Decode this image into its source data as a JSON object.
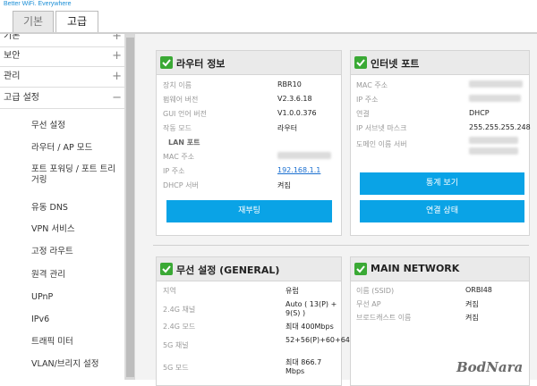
{
  "brand": "Better WiFi. Everywhere",
  "tabs": [
    {
      "label": "기본"
    },
    {
      "label": "고급"
    }
  ],
  "sidebar": {
    "categories": [
      {
        "label": "기본",
        "plus": "+"
      },
      {
        "label": "보안",
        "plus": "+"
      },
      {
        "label": "관리",
        "plus": "+"
      },
      {
        "label": "고급 설정",
        "plus": "−"
      }
    ],
    "items": [
      {
        "label": "무선 설정"
      },
      {
        "label": "라우터 / AP 모드"
      },
      {
        "label": "포트 포워딩 / 포트 트리거링"
      },
      {
        "label": "유동 DNS"
      },
      {
        "label": "VPN 서비스"
      },
      {
        "label": "고정 라우트"
      },
      {
        "label": "원격 관리"
      },
      {
        "label": "UPnP"
      },
      {
        "label": "IPv6"
      },
      {
        "label": "트래픽 미터"
      },
      {
        "label": "VLAN/브리지 설정"
      }
    ]
  },
  "router_info": {
    "title": "라우터 정보",
    "rows": [
      {
        "label": "장치 이름",
        "value": "RBR10"
      },
      {
        "label": "펌웨어 버전",
        "value": "V2.3.6.18"
      },
      {
        "label": "GUI 언어 버전",
        "value": "V1.0.0.376"
      },
      {
        "label": "작동 모드",
        "value": "라우터"
      }
    ],
    "lan_header": "LAN 포트",
    "lan_rows": [
      {
        "label": "MAC 주소",
        "value": ""
      },
      {
        "label": "IP 주소",
        "value": "192.168.1.1"
      },
      {
        "label": "DHCP 서버",
        "value": "켜짐"
      }
    ],
    "button": "재부팅"
  },
  "internet_port": {
    "title": "인터넷 포트",
    "rows": [
      {
        "label": "MAC 주소",
        "value": ""
      },
      {
        "label": "IP 주소",
        "value": ""
      },
      {
        "label": "연결",
        "value": "DHCP"
      },
      {
        "label": "IP 서브넷 마스크",
        "value": "255.255.255.248"
      },
      {
        "label": "도메인 이름 서버",
        "value": ""
      }
    ],
    "button_stats": "통계 보기",
    "button_status": "연결 상태"
  },
  "wireless": {
    "title": "무선 설정 (GENERAL)",
    "rows": [
      {
        "label": "지역",
        "value": "유럽"
      },
      {
        "label": "2.4G 채널",
        "value": "Auto ( 13(P) + 9(S) )"
      },
      {
        "label": "2.4G 모드",
        "value": "최대 400Mbps"
      },
      {
        "label": "5G 채널",
        "value": "52+56(P)+60+64"
      },
      {
        "label": "5G 모드",
        "value": "최대 866.7 Mbps"
      }
    ]
  },
  "main_network": {
    "title": "MAIN NETWORK",
    "rows": [
      {
        "label": "이름 (SSID)",
        "value": "ORBI48"
      },
      {
        "label": "무선 AP",
        "value": "켜짐"
      },
      {
        "label": "브로드캐스트 이름",
        "value": "켜짐"
      }
    ]
  },
  "watermark": "BodNara",
  "colors": {
    "accent": "#0aa3e6",
    "check": "#3aa935"
  }
}
